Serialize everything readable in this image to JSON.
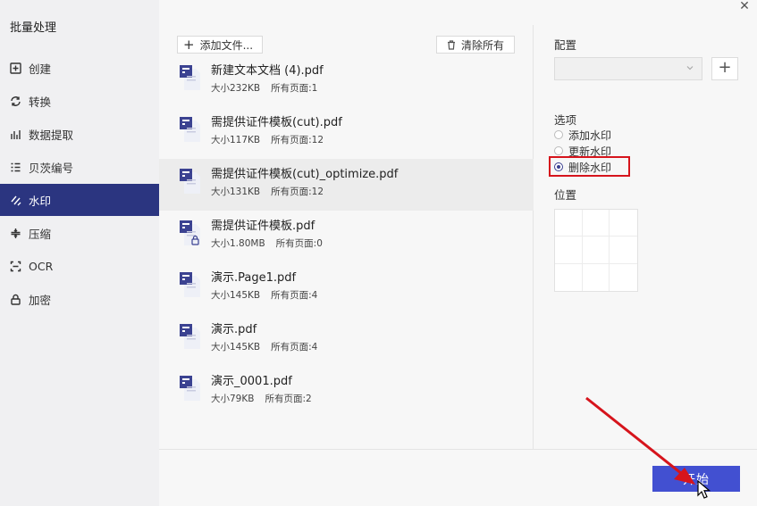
{
  "sidebar": {
    "title": "批量处理",
    "items": [
      {
        "label": "创建",
        "icon": "create-icon"
      },
      {
        "label": "转换",
        "icon": "convert-icon"
      },
      {
        "label": "数据提取",
        "icon": "data-extract-icon"
      },
      {
        "label": "贝茨编号",
        "icon": "bates-number-icon"
      },
      {
        "label": "水印",
        "icon": "watermark-icon",
        "active": true
      },
      {
        "label": "压缩",
        "icon": "compress-icon"
      },
      {
        "label": "OCR",
        "icon": "ocr-icon"
      },
      {
        "label": "加密",
        "icon": "lock-icon"
      }
    ]
  },
  "toolbar": {
    "add_label": "添加文件...",
    "clear_label": "清除所有"
  },
  "files": [
    {
      "name": "新建文本文档 (4).pdf",
      "size": "大小232KB",
      "pages": "所有页面:1"
    },
    {
      "name": "需提供证件模板(cut).pdf",
      "size": "大小117KB",
      "pages": "所有页面:12"
    },
    {
      "name": "需提供证件模板(cut)_optimize.pdf",
      "size": "大小131KB",
      "pages": "所有页面:12",
      "selected": true
    },
    {
      "name": "需提供证件模板.pdf",
      "size": "大小1.80MB",
      "pages": "所有页面:0",
      "locked": true
    },
    {
      "name": "演示.Page1.pdf",
      "size": "大小145KB",
      "pages": "所有页面:4"
    },
    {
      "name": "演示.pdf",
      "size": "大小145KB",
      "pages": "所有页面:4"
    },
    {
      "name": "演示_0001.pdf",
      "size": "大小79KB",
      "pages": "所有页面:2"
    }
  ],
  "config": {
    "config_label": "配置",
    "options_label": "选项",
    "options": [
      {
        "label": "添加水印",
        "checked": false
      },
      {
        "label": "更新水印",
        "checked": false
      },
      {
        "label": "删除水印",
        "checked": true
      }
    ],
    "position_label": "位置"
  },
  "start_label": "开始",
  "colors": {
    "accent": "#2b3580",
    "button": "#4250d1",
    "highlight": "#d6141c"
  }
}
